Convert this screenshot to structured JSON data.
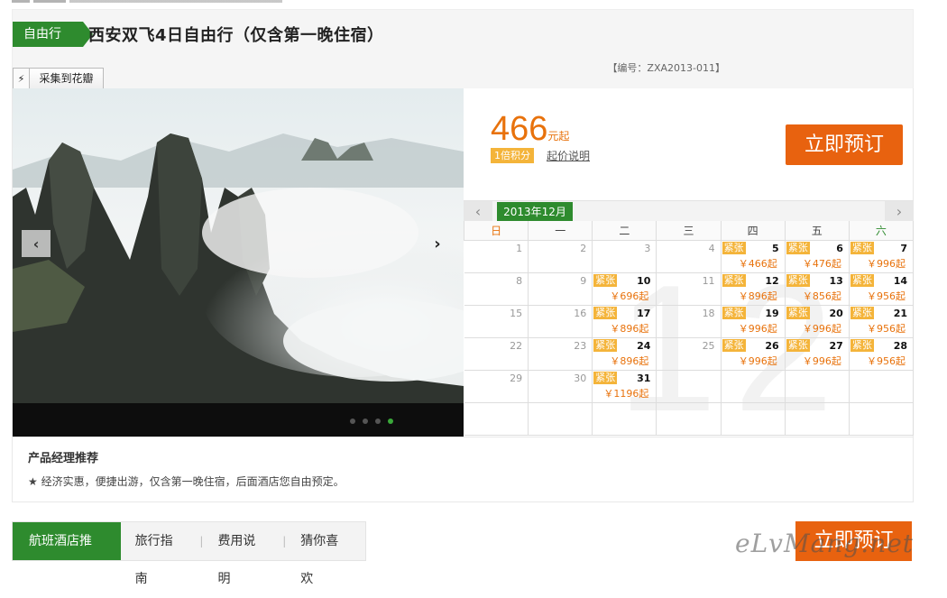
{
  "header": {
    "tag": "自由行",
    "title": "西安双飞4日自由行（仅含第一晚住宿）",
    "code": "【编号：ZXA2013-011】",
    "collect_label": "采集到花瓣",
    "collect_icon": "bolt-icon"
  },
  "booking": {
    "price": "466",
    "price_unit": "元起",
    "points_badge": "1倍积分",
    "start_price_note": "起价说明",
    "book_label": "立即预订"
  },
  "calendar": {
    "month_label": "2013年12月",
    "big_month": "12",
    "weekdays": [
      "日",
      "一",
      "二",
      "三",
      "四",
      "五",
      "六"
    ],
    "badge_text": "紧张",
    "weeks": [
      [
        {
          "day": "1",
          "badge": "",
          "price": ""
        },
        {
          "day": "2",
          "badge": "",
          "price": ""
        },
        {
          "day": "3",
          "badge": "",
          "price": ""
        },
        {
          "day": "4",
          "badge": "",
          "price": ""
        },
        {
          "day": "5",
          "badge": "紧张",
          "price": "￥466起"
        },
        {
          "day": "6",
          "badge": "紧张",
          "price": "￥476起"
        },
        {
          "day": "7",
          "badge": "紧张",
          "price": "￥996起"
        }
      ],
      [
        {
          "day": "8",
          "badge": "",
          "price": ""
        },
        {
          "day": "9",
          "badge": "",
          "price": ""
        },
        {
          "day": "10",
          "badge": "紧张",
          "price": "￥696起"
        },
        {
          "day": "11",
          "badge": "",
          "price": ""
        },
        {
          "day": "12",
          "badge": "紧张",
          "price": "￥896起"
        },
        {
          "day": "13",
          "badge": "紧张",
          "price": "￥856起"
        },
        {
          "day": "14",
          "badge": "紧张",
          "price": "￥956起"
        }
      ],
      [
        {
          "day": "15",
          "badge": "",
          "price": ""
        },
        {
          "day": "16",
          "badge": "",
          "price": ""
        },
        {
          "day": "17",
          "badge": "紧张",
          "price": "￥896起"
        },
        {
          "day": "18",
          "badge": "",
          "price": ""
        },
        {
          "day": "19",
          "badge": "紧张",
          "price": "￥996起"
        },
        {
          "day": "20",
          "badge": "紧张",
          "price": "￥996起"
        },
        {
          "day": "21",
          "badge": "紧张",
          "price": "￥956起"
        }
      ],
      [
        {
          "day": "22",
          "badge": "",
          "price": ""
        },
        {
          "day": "23",
          "badge": "",
          "price": ""
        },
        {
          "day": "24",
          "badge": "紧张",
          "price": "￥896起"
        },
        {
          "day": "25",
          "badge": "",
          "price": ""
        },
        {
          "day": "26",
          "badge": "紧张",
          "price": "￥996起"
        },
        {
          "day": "27",
          "badge": "紧张",
          "price": "￥996起"
        },
        {
          "day": "28",
          "badge": "紧张",
          "price": "￥956起"
        }
      ],
      [
        {
          "day": "29",
          "badge": "",
          "price": ""
        },
        {
          "day": "30",
          "badge": "",
          "price": ""
        },
        {
          "day": "31",
          "badge": "紧张",
          "price": "￥1196起"
        },
        {
          "day": "",
          "badge": "",
          "price": ""
        },
        {
          "day": "",
          "badge": "",
          "price": ""
        },
        {
          "day": "",
          "badge": "",
          "price": ""
        },
        {
          "day": "",
          "badge": "",
          "price": ""
        }
      ],
      [
        {
          "day": "",
          "badge": "",
          "price": ""
        },
        {
          "day": "",
          "badge": "",
          "price": ""
        },
        {
          "day": "",
          "badge": "",
          "price": ""
        },
        {
          "day": "",
          "badge": "",
          "price": ""
        },
        {
          "day": "",
          "badge": "",
          "price": ""
        },
        {
          "day": "",
          "badge": "",
          "price": ""
        },
        {
          "day": "",
          "badge": "",
          "price": ""
        }
      ]
    ]
  },
  "recommend": {
    "title": "产品经理推荐",
    "text": "★ 经济实惠，便捷出游，仅含第一晚住宿，后面酒店您自由预定。"
  },
  "tabs": [
    {
      "label": "航班酒店推荐",
      "active": true
    },
    {
      "label": "旅行指南",
      "active": false
    },
    {
      "label": "费用说明",
      "active": false
    },
    {
      "label": "猜你喜欢",
      "active": false
    }
  ],
  "bottom_book_label": "立即预订",
  "watermark": "eLvMang.net",
  "colors": {
    "green": "#2e8b2e",
    "orange": "#e8620f",
    "badge": "#f4b43a"
  }
}
